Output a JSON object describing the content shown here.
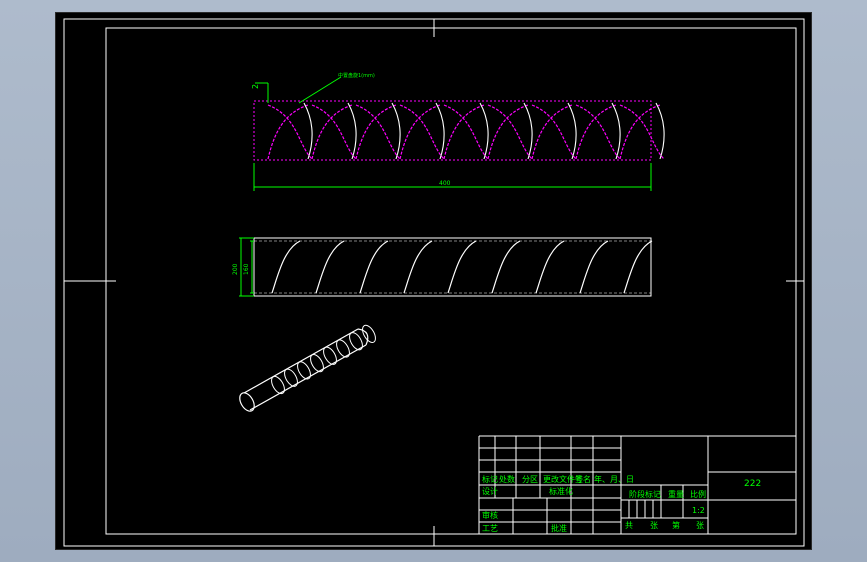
{
  "drawing": {
    "colors": {
      "background": "#000000",
      "frame": "#ffffff",
      "dimension": "#00ff00",
      "hidden_spiral": "#ff00ff",
      "spiral": "#ffffff",
      "titleblock": "#ffffff",
      "titleblock_text": "#00ff00"
    },
    "views": {
      "top": {
        "length_dim": "400",
        "leader_label": "2",
        "callout": "中置盘旋1(mm)"
      },
      "front": {
        "outer_dim": "200",
        "inner_dim": "160"
      },
      "iso": {}
    },
    "title_block": {
      "drawing_code": "222",
      "scale": "1:2",
      "labels": {
        "mark": "标记",
        "count": "处数",
        "zone": "分区",
        "change_doc": "更改文件号",
        "signature": "签名",
        "date": "年、月、日",
        "design": "设计",
        "standardize": "标准化",
        "stage_mark": "阶段标记",
        "weight": "重量",
        "scale": "比例",
        "review": "审核",
        "process": "工艺",
        "approve": "批准",
        "total": "共",
        "sheets": "张",
        "page": "第",
        "sheet": "张"
      }
    }
  }
}
